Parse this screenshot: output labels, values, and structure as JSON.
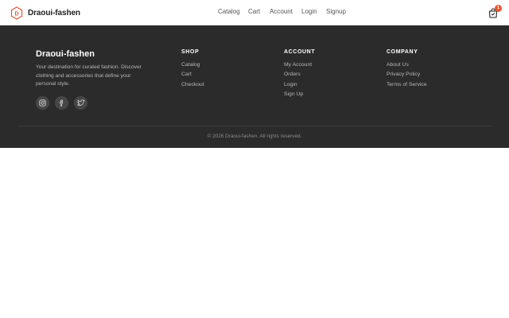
{
  "header": {
    "brand_name": "Draoui-fashen",
    "logo_letter": "D",
    "nav": [
      {
        "label": "Catalog"
      },
      {
        "label": "Cart"
      },
      {
        "label": "Account"
      },
      {
        "label": "Login"
      },
      {
        "label": "Signup"
      }
    ],
    "cart_icon": "shopping-bag-icon",
    "cart_count": "1"
  },
  "footer": {
    "brand_name": "Draoui-fashen",
    "description": "Your destination for curated fashion. Discover clothing and accessories that define your personal style.",
    "socials": [
      {
        "icon": "instagram-icon"
      },
      {
        "icon": "facebook-icon"
      },
      {
        "icon": "twitter-icon"
      }
    ],
    "shop": {
      "title": "SHOP",
      "links": [
        "Catalog",
        "Cart",
        "Checkout"
      ]
    },
    "account": {
      "title": "ACCOUNT",
      "links": [
        "My Account",
        "Orders",
        "Login",
        "Sign Up"
      ]
    },
    "company": {
      "title": "COMPANY",
      "links": [
        "About Us",
        "Privacy Policy",
        "Terms of Service"
      ]
    },
    "copyright": "© 2026 Draoui-fashen. All rights reserved."
  },
  "colors": {
    "accent": "#e4572e",
    "footer_bg": "#2b2b2b",
    "header_bg": "#ffffff"
  }
}
